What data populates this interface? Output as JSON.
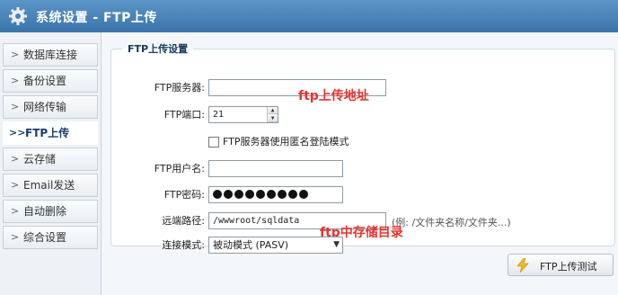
{
  "header": {
    "title": "系统设置 - FTP上传",
    "icon": "gear-icon"
  },
  "sidebar": {
    "items": [
      {
        "label": "数据库连接",
        "arrow": ">"
      },
      {
        "label": "备份设置",
        "arrow": ">"
      },
      {
        "label": "网络传输",
        "arrow": ">"
      },
      {
        "label": "FTP上传",
        "arrow": ">>",
        "active": true
      },
      {
        "label": "云存储",
        "arrow": ">"
      },
      {
        "label": "Email发送",
        "arrow": ">"
      },
      {
        "label": "自动删除",
        "arrow": ">"
      },
      {
        "label": "综合设置",
        "arrow": ">"
      }
    ]
  },
  "form": {
    "legend": "FTP上传设置",
    "server": {
      "label": "FTP服务器:",
      "value": ""
    },
    "port": {
      "label": "FTP端口:",
      "value": "21"
    },
    "anonymous": {
      "label": "FTP服务器使用匿名登陆模式",
      "checked": false
    },
    "username": {
      "label": "FTP用户名:",
      "value": ""
    },
    "password": {
      "label": "FTP密码:",
      "masked_length": 9
    },
    "remote_path": {
      "label": "远端路径:",
      "value": "/wwwroot/sqldata",
      "hint": "(例: /文件夹名称/文件夹...)"
    },
    "connect_mode": {
      "label": "连接模式:",
      "value": "被动模式 (PASV)"
    }
  },
  "annotations": {
    "server_note": "ftp上传地址",
    "path_note": "ftp中存储目录"
  },
  "buttons": {
    "test": "FTP上传测试"
  },
  "colors": {
    "header": "#3b74aa",
    "annotation": "#e53330",
    "legend": "#1a3a60"
  }
}
